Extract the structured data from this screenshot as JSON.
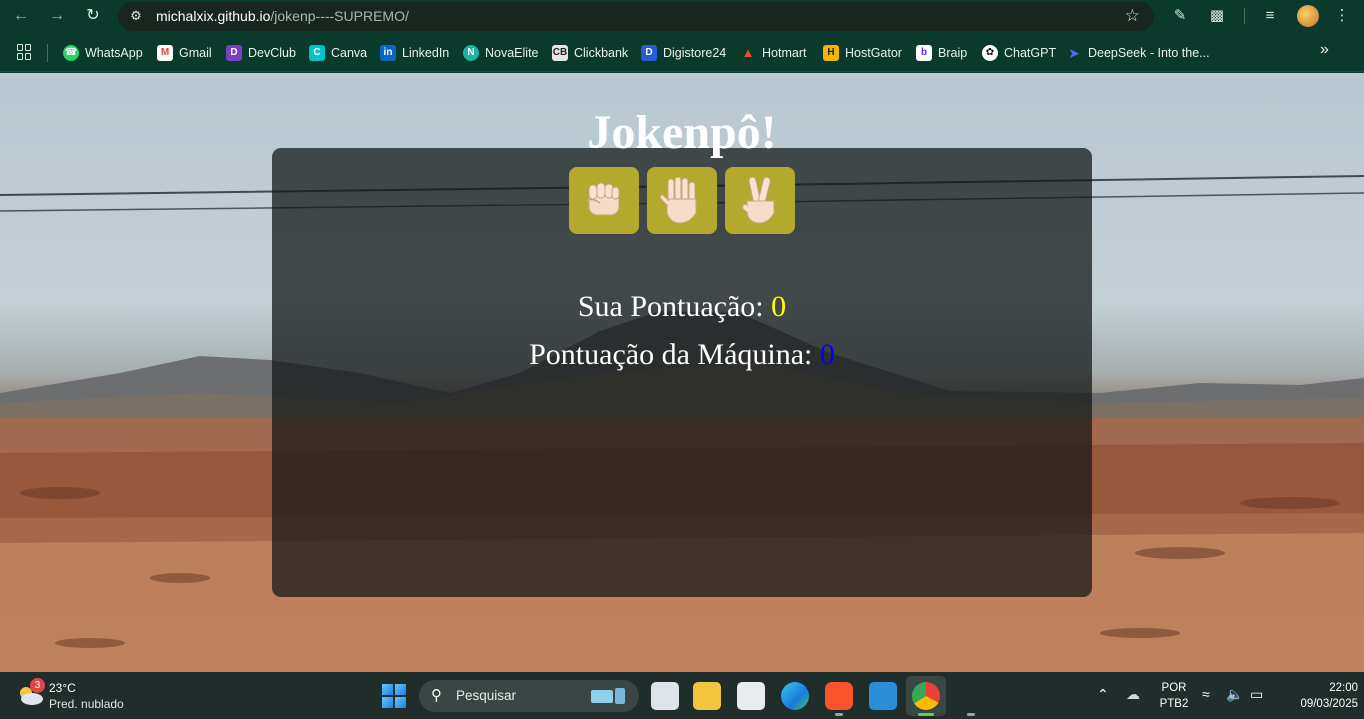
{
  "browser": {
    "url_host": "michalxix.github.io",
    "url_path": "/jokenp----SUPREMO/",
    "bookmarks": [
      {
        "label": "WhatsApp",
        "icon": "whatsapp-icon",
        "color": "#25d366"
      },
      {
        "label": "Gmail",
        "icon": "gmail-icon",
        "color": "#ea4335"
      },
      {
        "label": "DevClub",
        "icon": "devclub-icon",
        "color": "#7b3fc4"
      },
      {
        "label": "Canva",
        "icon": "canva-icon",
        "color": "#00c4cc"
      },
      {
        "label": "LinkedIn",
        "icon": "linkedin-icon",
        "color": "#0a66c2"
      },
      {
        "label": "NovaElite",
        "icon": "novaelite-icon",
        "color": "#1bb3a8"
      },
      {
        "label": "Clickbank",
        "icon": "clickbank-icon",
        "color": "#e6e6e6"
      },
      {
        "label": "Digistore24",
        "icon": "digistore-icon",
        "color": "#2a5bd7"
      },
      {
        "label": "Hotmart",
        "icon": "hotmart-icon",
        "color": "#f04e23"
      },
      {
        "label": "HostGator",
        "icon": "hostgator-icon",
        "color": "#f5b400"
      },
      {
        "label": "Braip",
        "icon": "braip-icon",
        "color": "#ffffff"
      },
      {
        "label": "ChatGPT",
        "icon": "chatgpt-icon",
        "color": "#ffffff"
      },
      {
        "label": "DeepSeek - Into the...",
        "icon": "deepseek-icon",
        "color": "#4d6bfe"
      }
    ]
  },
  "game": {
    "title": "Jokenpô!",
    "choices": [
      {
        "name": "rock",
        "icon": "fist-icon"
      },
      {
        "name": "paper",
        "icon": "open-hand-icon"
      },
      {
        "name": "scissors",
        "icon": "victory-hand-icon"
      }
    ],
    "your_score_label": "Sua Pontuação: ",
    "your_score": "0",
    "machine_score_label": "Pontuação da Máquina: ",
    "machine_score": "0",
    "colors": {
      "choice_bg": "#b3a92c",
      "your_score": "#ffff00",
      "machine_score": "#0000ff"
    }
  },
  "taskbar": {
    "weather_badge": "3",
    "temperature": "23°C",
    "weather_desc": "Pred. nublado",
    "search_placeholder": "Pesquisar",
    "language_line1": "POR",
    "language_line2": "PTB2",
    "time": "22:00",
    "date": "09/03/2025"
  }
}
